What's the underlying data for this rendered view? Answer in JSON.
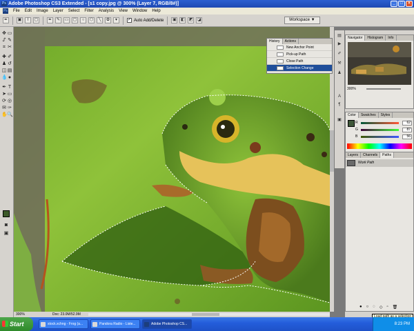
{
  "window": {
    "title": "Adobe Photoshop CS3 Extended - [s1 copy.jpg @ 300% (Layer 7, RGB/8#)]"
  },
  "menu": [
    "File",
    "Edit",
    "Image",
    "Layer",
    "Select",
    "Filter",
    "Analysis",
    "View",
    "Window",
    "Help"
  ],
  "options": {
    "auto_add_delete_label": "Auto Add/Delete",
    "workspace_label": "Workspace ▼"
  },
  "history_panel": {
    "tabs": [
      "History",
      "Actions"
    ],
    "items": [
      "New Anchor Point",
      "Pick-up Path",
      "Close Path",
      "Selection Change"
    ],
    "selected_index": 3
  },
  "navigator_panel": {
    "tabs": [
      "Navigator",
      "Histogram",
      "Info"
    ],
    "zoom": "300%"
  },
  "color_panel": {
    "tabs": [
      "Color",
      "Swatches",
      "Styles"
    ],
    "channels": [
      {
        "label": "R",
        "value": "62"
      },
      {
        "label": "G",
        "value": "87"
      },
      {
        "label": "B",
        "value": "56"
      }
    ],
    "foreground": "#3e5738"
  },
  "layers_panel": {
    "tabs": [
      "Layers",
      "Channels",
      "Paths"
    ],
    "path_name": "Work Path"
  },
  "status": {
    "zoom": "300%",
    "doc": "Doc: 23.0M/52.9M"
  },
  "tooltip": "Load path as a selection",
  "taskbar": {
    "start_label": "Start",
    "tasks": [
      "stock.xchng - Frog (a...",
      "Pandora Radio - Liste...",
      "Adobe Photoshop CS..."
    ],
    "clock": "8:23 PM"
  }
}
